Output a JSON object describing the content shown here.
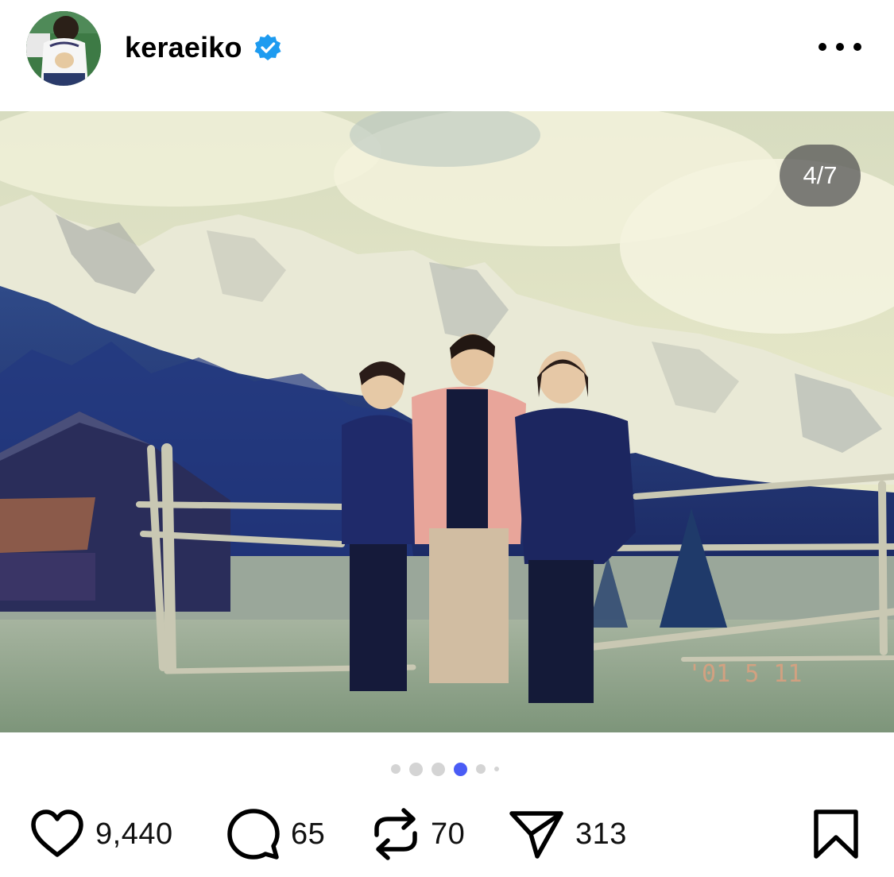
{
  "post": {
    "username": "keraeiko",
    "verified": true,
    "counter": "4/7",
    "carousel": {
      "total": 6,
      "active_index": 3
    }
  },
  "actions": {
    "likes": "9,440",
    "comments": "65",
    "reposts": "70",
    "shares": "313"
  },
  "photo": {
    "date_stamp": "'01 5 11"
  },
  "colors": {
    "active_dot": "#4a5cf5",
    "verified_blue": "#1d9bf0",
    "inactive_dot": "#d4d4d4"
  },
  "icons": [
    "verified-badge-icon",
    "more-icon",
    "heart-icon",
    "comment-icon",
    "repost-icon",
    "send-icon",
    "bookmark-icon"
  ]
}
